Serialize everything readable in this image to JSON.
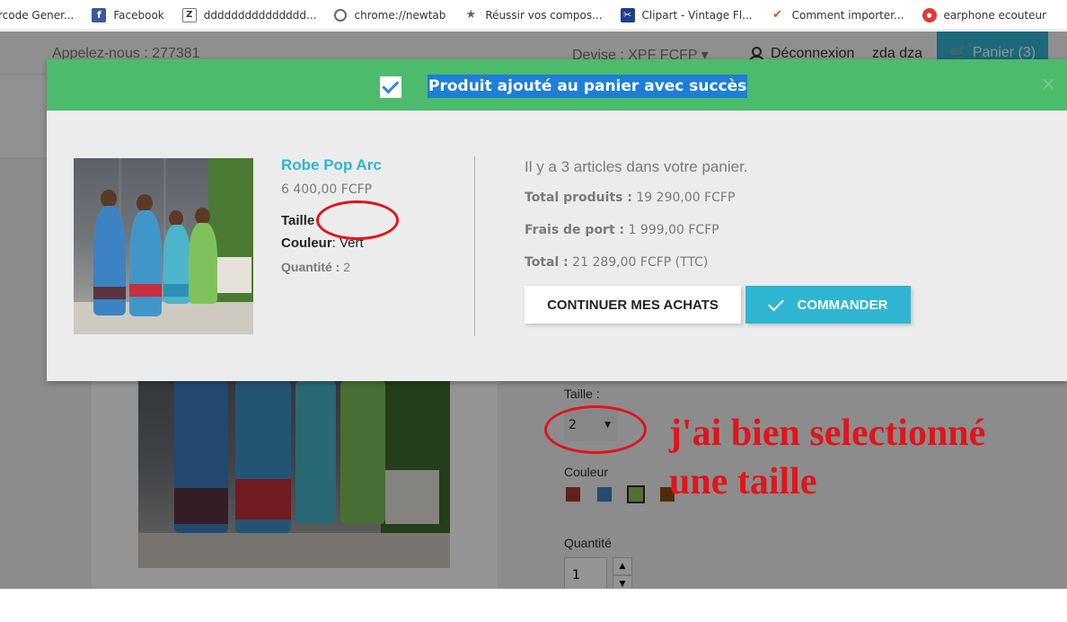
{
  "bookmarks": [
    {
      "label": "rcode Gener...",
      "icon": "barcode-icon"
    },
    {
      "label": "Facebook",
      "icon": "facebook-icon"
    },
    {
      "label": "ddddddddddddddd...",
      "icon": "z-icon"
    },
    {
      "label": "chrome://newtab",
      "icon": "globe-icon"
    },
    {
      "label": "Réussir vos compos...",
      "icon": "runner-icon"
    },
    {
      "label": "Clipart - Vintage Fl...",
      "icon": "clipart-icon"
    },
    {
      "label": "Comment importer...",
      "icon": "import-icon"
    },
    {
      "label": "earphone ecouteur",
      "icon": "earphone-icon"
    }
  ],
  "topnav": {
    "call": "Appelez-nous : 277381",
    "devise": "Devise : XPF FCFP ▾",
    "logout": "Déconnexion",
    "user": "zda dza",
    "cart": "Panier (3)"
  },
  "modal": {
    "title": "Produit ajouté au panier avec succès",
    "close": "×",
    "product": {
      "name": "Robe Pop Arc",
      "price": "6 400,00 FCFP",
      "size_label": "Taille",
      "size_value": "",
      "color_label": "Couleur",
      "color_value": ": Vert",
      "qty_label": "Quantité :",
      "qty_value": " 2"
    },
    "summary": {
      "count_text": "Il y a 3 articles dans votre panier.",
      "products_label": "Total produits :",
      "products_value": " 19 290,00 FCFP",
      "shipping_label": "Frais de port :",
      "shipping_value": " 1 999,00 FCFP",
      "total_label": "Total :",
      "total_value": " 21 289,00 FCFP (TTC)"
    },
    "buttons": {
      "continue": "CONTINUER MES ACHATS",
      "order": "COMMANDER"
    }
  },
  "product_page": {
    "size_label": "Taille :",
    "size_selected": "2",
    "color_label": "Couleur",
    "colors": [
      "#a83a2f",
      "#3f7fc4",
      "#8fbf5a",
      "#8a4a14"
    ],
    "selected_color": 2,
    "qty_label": "Quantité",
    "qty_value": "1"
  },
  "annotation": {
    "text": "j'ai bien selectionné une taille",
    "color": "#e0151b"
  },
  "colors": {
    "accent": "#2fb5d2",
    "success": "#4cbb6c",
    "highlight": "#1e7ed6"
  }
}
